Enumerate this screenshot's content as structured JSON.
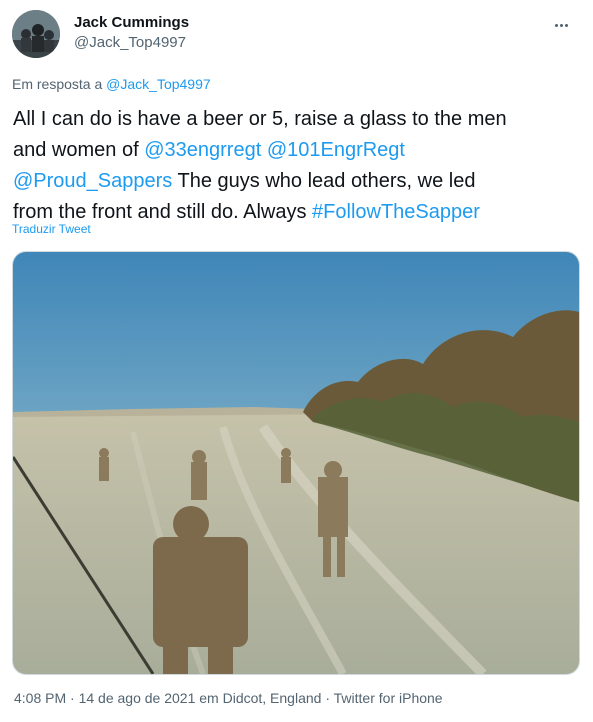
{
  "author": {
    "name": "Jack Cummings",
    "handle": "@Jack_Top4997"
  },
  "reply": {
    "prefix": "Em resposta a",
    "to": "@Jack_Top4997"
  },
  "tweet": {
    "line1": "All I can do is have a beer or 5, raise a glass to the men",
    "and_women_of": "and women of",
    "mention1": "@33engrregt",
    "mention2": "@101EngrRegt",
    "mention3": "@Proud_Sappers",
    "after_mentions": "The guys who lead others, we led",
    "line4": "from the front and still do. Always",
    "hashtag": "#FollowTheSapper"
  },
  "translate_label": "Traduzir Tweet",
  "meta": {
    "time": "4:08 PM",
    "sep1": "·",
    "date": "14 de ago de 2021 em Didcot, England",
    "sep2": "·",
    "source": "Twitter for iPhone"
  },
  "icons": {
    "more": "more-horizontal-icon"
  },
  "colors": {
    "link": "#1d9bf0",
    "secondary_text": "#536471",
    "primary_text": "#0f1419"
  }
}
